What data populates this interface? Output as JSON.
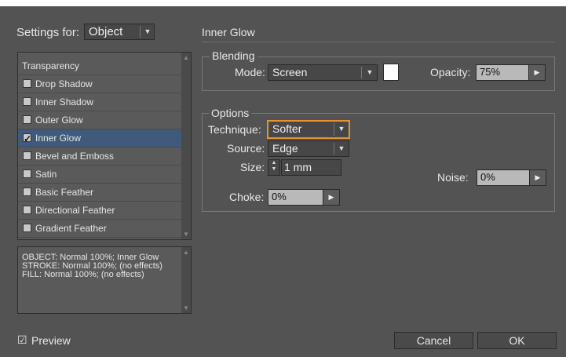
{
  "settings_for": {
    "label": "Settings for:",
    "value": "Object"
  },
  "effects_list": [
    {
      "label": "Transparency",
      "checkbox": false,
      "checked": false
    },
    {
      "label": "Drop Shadow",
      "checkbox": true,
      "checked": false
    },
    {
      "label": "Inner Shadow",
      "checkbox": true,
      "checked": false
    },
    {
      "label": "Outer Glow",
      "checkbox": true,
      "checked": false
    },
    {
      "label": "Inner Glow",
      "checkbox": true,
      "checked": true,
      "selected": true
    },
    {
      "label": "Bevel and Emboss",
      "checkbox": true,
      "checked": false
    },
    {
      "label": "Satin",
      "checkbox": true,
      "checked": false
    },
    {
      "label": "Basic Feather",
      "checkbox": true,
      "checked": false
    },
    {
      "label": "Directional Feather",
      "checkbox": true,
      "checked": false
    },
    {
      "label": "Gradient Feather",
      "checkbox": true,
      "checked": false
    }
  ],
  "summary": {
    "line1": "OBJECT: Normal 100%; Inner Glow",
    "line2": "STROKE: Normal 100%; (no effects)",
    "line3": "FILL: Normal 100%; (no effects)"
  },
  "panel_title": "Inner Glow",
  "blending": {
    "title": "Blending",
    "mode_label": "Mode:",
    "mode_value": "Screen",
    "opacity_label": "Opacity:",
    "opacity_value": "75%"
  },
  "options": {
    "title": "Options",
    "technique_label": "Technique:",
    "technique_value": "Softer",
    "source_label": "Source:",
    "source_value": "Edge",
    "size_label": "Size:",
    "size_value": "1 mm",
    "noise_label": "Noise:",
    "noise_value": "0%",
    "choke_label": "Choke:",
    "choke_value": "0%"
  },
  "preview": {
    "label": "Preview",
    "checked": true
  },
  "buttons": {
    "cancel": "Cancel",
    "ok": "OK"
  },
  "colors": {
    "dialog_bg": "#535353",
    "selected_row": "#3f5a7a",
    "focus_orange": "#e8912f",
    "glow_color": "#ffffff"
  },
  "icons": {
    "dropdown_arrow": "triangle-down-icon",
    "play_arrow": "triangle-right-icon",
    "stepper": "up-down-stepper-icon",
    "checkmark": "checkmark-icon"
  }
}
